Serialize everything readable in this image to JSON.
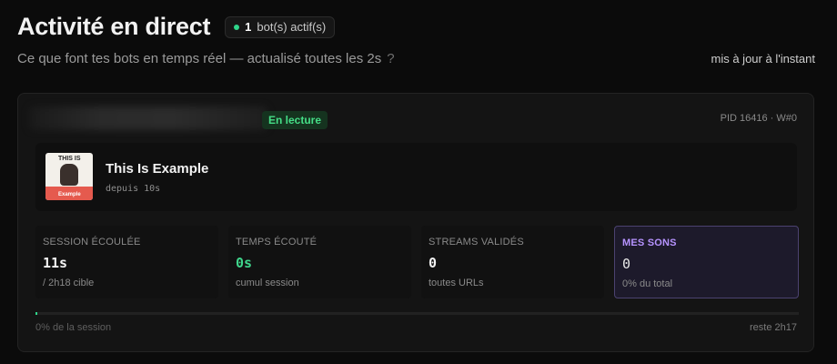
{
  "header": {
    "title": "Activité en direct",
    "badge": {
      "count": "1",
      "label": "bot(s) actif(s)"
    },
    "subtitle": "Ce que font tes bots en temps réel — actualisé toutes les 2s",
    "help_symbol": "?",
    "updated": "mis à jour à l'instant"
  },
  "colors": {
    "accent_green": "#2fd58a",
    "accent_purple": "#b693ff"
  },
  "bot_card": {
    "status": "En lecture",
    "pid": "PID 16416 · W#0",
    "track": {
      "title": "This Is Example",
      "since": "depuis 10s",
      "cover_top": "THIS IS",
      "cover_label": "Example"
    },
    "stats": [
      {
        "label": "SESSION ÉCOULÉE",
        "value": "11s",
        "sub": "/ 2h18 cible"
      },
      {
        "label": "TEMPS ÉCOUTÉ",
        "value": "0s",
        "sub": "cumul session"
      },
      {
        "label": "STREAMS VALIDÉS",
        "value": "0",
        "sub": "toutes URLs"
      },
      {
        "label": "MES SONS",
        "value": "0",
        "sub": "0% du total"
      }
    ],
    "progress": {
      "fraction": 0.002,
      "left_label": "0% de la session",
      "right_label": "reste 2h17"
    }
  }
}
